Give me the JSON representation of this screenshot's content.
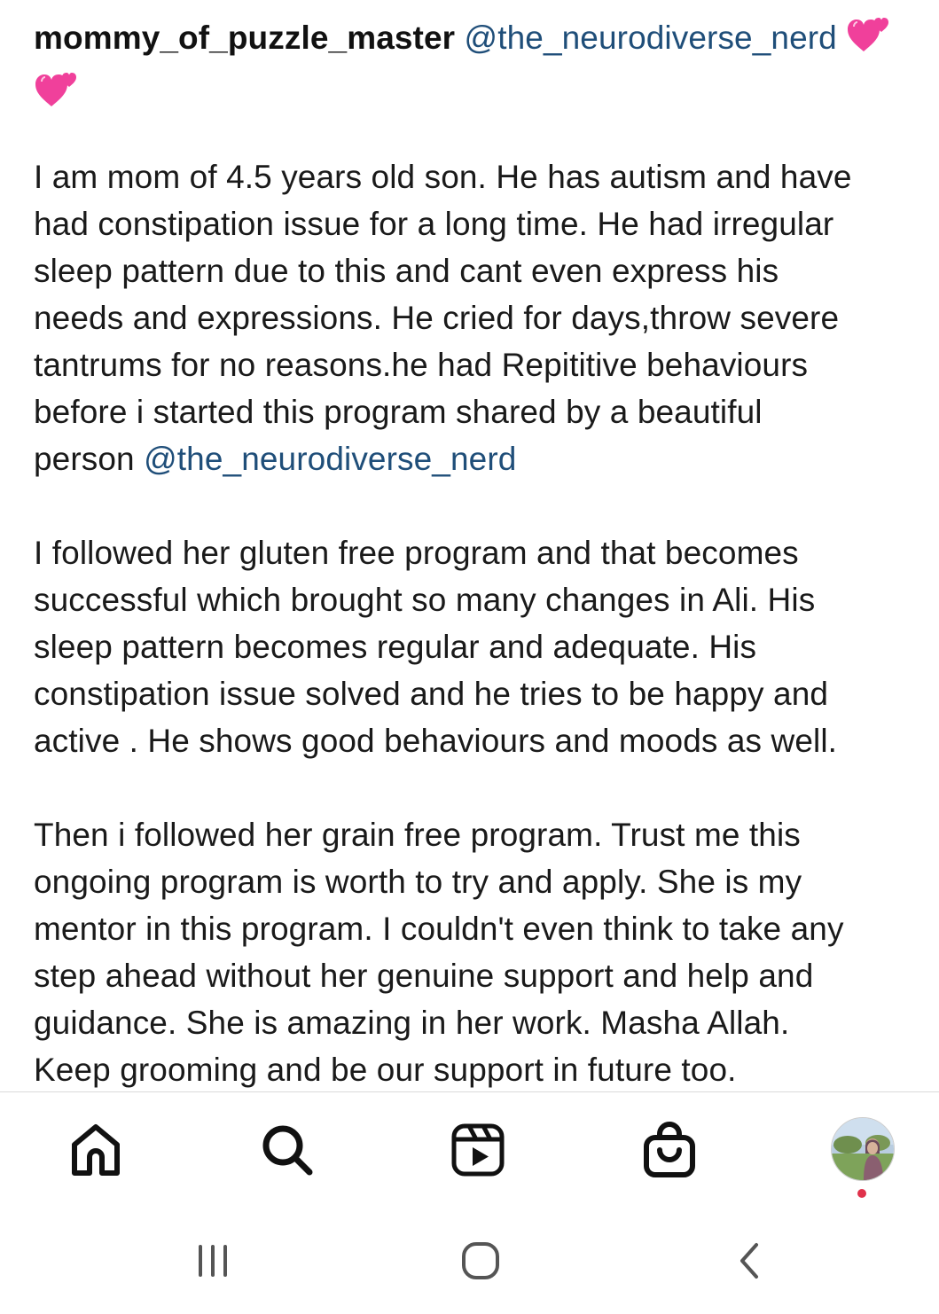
{
  "post": {
    "username": "mommy_of_puzzle_master",
    "mention": "@the_neurodiverse_nerd",
    "paragraphs": [
      {
        "lines": [
          "I am mom of 4.5 years old son. He has autism and have",
          "had constipation issue for a long time. He had irregular",
          "sleep pattern due to this and cant even express his",
          "needs and expressions. He cried for days,throw severe",
          "tantrums for no reasons.he had Repititive behaviours",
          "before i started this program shared by a beautiful"
        ],
        "last_prefix": "person ",
        "last_mention": "@the_neurodiverse_nerd"
      },
      {
        "lines": [
          "I followed her gluten free program and that becomes",
          "successful which brought so many changes in Ali. His",
          "sleep pattern becomes regular and adequate. His",
          "constipation issue solved and he tries to be happy and",
          "active . He shows good behaviours and moods as well."
        ]
      },
      {
        "lines": [
          "Then i followed her grain free program. Trust me this",
          "ongoing program is worth to try and apply. She is my",
          "mentor in this program. I couldn't even think to take any",
          "step ahead without her genuine support and help and",
          "guidance. She is amazing in her work. Masha Allah.",
          "Keep grooming and be our support in future too."
        ]
      }
    ]
  },
  "icons": {
    "heart": "two-hearts-emoji",
    "home": "home-icon",
    "search": "search-icon",
    "reels": "reels-icon",
    "shop": "shop-bag-icon",
    "profile": "profile-avatar"
  },
  "colors": {
    "mention": "#1f4e79",
    "text": "#1a1a1a",
    "heart": "#f0409b",
    "notification": "#e0324b"
  }
}
